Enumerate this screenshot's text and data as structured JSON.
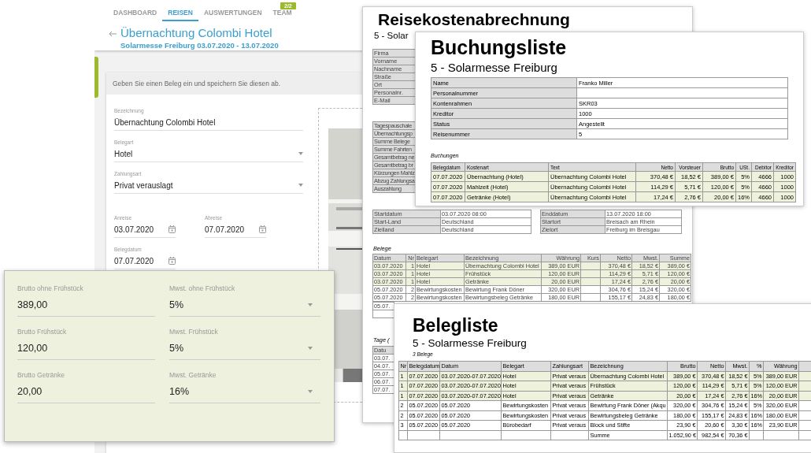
{
  "app": {
    "tabs": [
      {
        "label": "DASHBOARD",
        "selected": false
      },
      {
        "label": "REISEN",
        "selected": true
      },
      {
        "label": "AUSWERTUNGEN",
        "selected": false
      },
      {
        "label": "TEAM",
        "selected": false
      }
    ],
    "badge": "2/2",
    "title": "Übernachtung Colombi Hotel",
    "subtitle": "Solarmesse Freiburg 03.07.2020 - 13.07.2020",
    "hint": "Geben Sie einen Beleg ein und speichern Sie diesen ab.",
    "fields": [
      {
        "kind": "text",
        "label": "Bezeichnung",
        "value": "Übernachtung Colombi Hotel"
      },
      {
        "kind": "select",
        "label": "Belegart",
        "value": "Hotel"
      },
      {
        "kind": "select",
        "label": "Zahlungsart",
        "value": "Privat verauslagt"
      },
      {
        "kind": "date",
        "label": "Anreise",
        "value": "03.07.2020"
      },
      {
        "kind": "date",
        "label": "Abreise",
        "value": "07.07.2020"
      },
      {
        "kind": "date",
        "label": "Belegdatum",
        "value": "07.07.2020"
      }
    ]
  },
  "amounts_panel": {
    "fields": [
      {
        "kind": "text",
        "label": "Brutto ohne Frühstück",
        "value": "389,00"
      },
      {
        "kind": "select",
        "label": "Mwst. ohne Frühstück",
        "value": "5%"
      },
      {
        "kind": "text",
        "label": "Brutto Frühstück",
        "value": "120,00"
      },
      {
        "kind": "select",
        "label": "Mwst. Frühstück",
        "value": "5%"
      },
      {
        "kind": "text",
        "label": "Brutto Getränke",
        "value": "20,00"
      },
      {
        "kind": "select",
        "label": "Mwst. Getränke",
        "value": "16%"
      }
    ]
  },
  "reisekosten": {
    "title": "Reisekostenabrechnung",
    "subtitle": "5 - Solar",
    "person_labels": [
      "Firma",
      "Vorname",
      "Nachname",
      "Straße",
      "Ort",
      "Personalnr.",
      "E-Mail"
    ],
    "summary_labels": [
      "Tagespauschale",
      "Übernachtungsp",
      "Summe Belege",
      "Summe Fahrten",
      "Gesamtbetrag ne",
      "Gesamtbetrag br",
      "Kürzungen Mahlz",
      "Abzug Zahlungsa",
      "Auszahlung"
    ],
    "trip_rows": [
      [
        "Startdatum",
        "03.07.2020 08:00",
        "Enddatum",
        "13.07.2020 18:00"
      ],
      [
        "Start-Land",
        "Deutschland",
        "Startort",
        "Breisach am Rhein"
      ],
      [
        "Zielland",
        "Deutschland",
        "Zielort",
        "Freiburg im Breisgau"
      ]
    ],
    "belege_caption": "Belege",
    "belege_columns": [
      "Datum",
      "Nr",
      "Belegart",
      "Bezeichnung",
      "Währung",
      "Kurs",
      "Netto",
      "Mwst.",
      "Summe"
    ],
    "belege_rows": [
      {
        "highlighted": true,
        "cells": [
          "03.07.2020",
          "1",
          "Hotel",
          "Übernachtung Colombi Hotel",
          "389,00 EUR",
          null,
          "370,48 €",
          "18,52 €",
          "389,00 €"
        ]
      },
      {
        "highlighted": true,
        "cells": [
          "03.07.2020",
          "1",
          "Hotel",
          "Frühstück",
          "120,00 EUR",
          null,
          "114,29 €",
          "5,71 €",
          "120,00 €"
        ]
      },
      {
        "highlighted": true,
        "cells": [
          "03.07.2020",
          "1",
          "Hotel",
          "Getränke",
          "20,00 EUR",
          null,
          "17,24 €",
          "2,76 €",
          "20,00 €"
        ]
      },
      {
        "highlighted": false,
        "cells": [
          "05.07.2020",
          "2",
          "Bewirtungskosten",
          "Bewirtung Frank Döner",
          "320,00 EUR",
          null,
          "304,76 €",
          "15,24 €",
          "320,00 €"
        ]
      },
      {
        "highlighted": false,
        "cells": [
          "05.07.2020",
          "2",
          "Bewirtungskosten",
          "Bewirtungsbeleg Getränke",
          "180,00 EUR",
          null,
          "155,17 €",
          "24,83 €",
          "180,00 €"
        ]
      }
    ],
    "belege_cut_cell": "05.07.",
    "tage_caption": "Tage (",
    "tage_header": "Datu",
    "tage_rows": [
      "03.07.",
      "04.07.",
      "05.07.",
      "06.07.",
      "07.07."
    ]
  },
  "buchungsliste": {
    "title": "Buchungsliste",
    "subtitle": "5 - Solarmesse Freiburg",
    "info_rows": [
      [
        "Name",
        "Franko Miller"
      ],
      [
        "Personalnummer",
        null
      ],
      [
        "Kontenrahmen",
        "SKR03"
      ],
      [
        "Kreditor",
        "1000"
      ],
      [
        "Status",
        "Angestellt"
      ],
      [
        "Reisenummer",
        "5"
      ]
    ],
    "caption": "Buchungen",
    "columns": [
      "Belegdatum",
      "Kostenart",
      "Text",
      "Netto",
      "Vorsteuer",
      "Brutto",
      "USt.",
      "Debitor",
      "Kreditor"
    ],
    "rows": [
      {
        "highlighted": true,
        "cells": [
          "07.07.2020",
          "Übernachtung (Hotel)",
          "Übernachtung Colombi Hotel",
          "370,48 €",
          "18,52 €",
          "389,00 €",
          "5%",
          "4666",
          "1000"
        ]
      },
      {
        "highlighted": true,
        "cells": [
          "07.07.2020",
          "Mahlzeit (Hotel)",
          "Übernachtung Colombi Hotel",
          "114,29 €",
          "5,71 €",
          "120,00 €",
          "5%",
          "4660",
          "1000"
        ]
      },
      {
        "highlighted": true,
        "cells": [
          "07.07.2020",
          "Getränke (Hotel)",
          "Übernachtung Colombi Hotel",
          "17,24 €",
          "2,76 €",
          "20,00 €",
          "16%",
          "4660",
          "1000"
        ]
      }
    ]
  },
  "belegliste": {
    "title": "Belegliste",
    "subtitle": "5 - Solarmesse Freiburg",
    "count": "3 Belege",
    "columns": [
      "Nr",
      "Belegdatum",
      "Datum",
      "Belegart",
      "Zahlungsart",
      "Bezeichnung",
      "Brutto",
      "Netto",
      "Mwst.",
      "%",
      "Währung",
      null
    ],
    "rows": [
      {
        "highlighted": true,
        "cells": [
          "1",
          "07.07.2020",
          "03.07.2020-07.07.2020",
          "Hotel",
          "Privat veraus",
          "Übernachtung Colombi Hotel",
          "389,00 €",
          "370,48 €",
          "18,52 €",
          "5%",
          "389,00 EUR",
          null
        ]
      },
      {
        "highlighted": true,
        "cells": [
          "1",
          "07.07.2020",
          "03.07.2020-07.07.2020",
          "Hotel",
          "Privat veraus",
          "Frühstück",
          "120,00 €",
          "114,29 €",
          "5,71 €",
          "5%",
          "120,00 EUR",
          null
        ]
      },
      {
        "highlighted": true,
        "cells": [
          "1",
          "07.07.2020",
          "03.07.2020-07.07.2020",
          "Hotel",
          "Privat veraus",
          "Getränke",
          "20,00 €",
          "17,24 €",
          "2,76 €",
          "16%",
          "20,00 EUR",
          null
        ]
      },
      {
        "highlighted": false,
        "cells": [
          "2",
          "05.07.2020",
          "05.07.2020",
          "Bewirtungskosten",
          "Privat veraus",
          "Bewirtung Frank Döner (Akqu",
          "320,00 €",
          "304,76 €",
          "15,24 €",
          "5%",
          "320,00 EUR",
          null
        ]
      },
      {
        "highlighted": false,
        "cells": [
          "2",
          "05.07.2020",
          "05.07.2020",
          "Bewirtungskosten",
          "Privat veraus",
          "Bewirtungsbeleg Getränke",
          "180,00 €",
          "155,17 €",
          "24,83 €",
          "16%",
          "180,00 EUR",
          null
        ]
      },
      {
        "highlighted": false,
        "cells": [
          "3",
          "05.07.2020",
          "05.07.2020",
          "Bürobedarf",
          "Privat veraus",
          "Block und Stifte",
          "23,90 €",
          "20,60 €",
          "3,30 €",
          "16%",
          "23,90 EUR",
          null
        ]
      },
      {
        "highlighted": false,
        "cells": [
          null,
          null,
          null,
          null,
          null,
          "Summe",
          "1.052,90 €",
          "982,54 €",
          "70,36 €",
          null,
          null,
          null
        ]
      }
    ]
  }
}
